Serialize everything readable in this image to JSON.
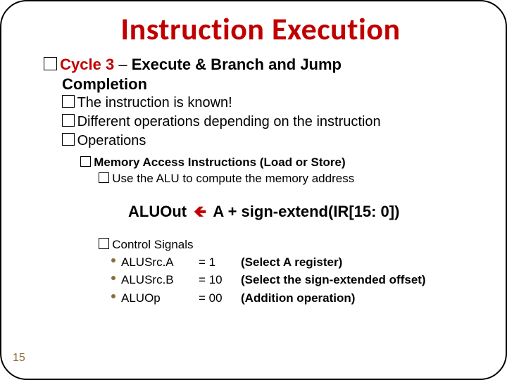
{
  "title": "Instruction Execution",
  "l1": {
    "cycle": "Cycle 3",
    "dash": " – ",
    "rest": "Execute & Branch and Jump"
  },
  "l1_cont": "Completion",
  "l2": {
    "a": "The instruction is known!",
    "b": "Different operations depending on the instruction",
    "c": "Operations"
  },
  "l3": "Memory Access Instructions (Load or Store)",
  "l4": "Use the ALU to compute the memory address",
  "formula": {
    "lhs": "ALUOut",
    "rhs": "A + sign-extend(IR[15: 0])"
  },
  "ctrl": {
    "head": "Control Signals",
    "rows": [
      {
        "name": "ALUSrc.A",
        "val": "= 1",
        "desc": "(Select A register)"
      },
      {
        "name": "ALUSrc.B",
        "val": "= 10",
        "desc": "(Select the sign-extended offset)"
      },
      {
        "name": "ALUOp",
        "val": "= 00",
        "desc": "(Addition operation)"
      }
    ]
  },
  "page": "15"
}
